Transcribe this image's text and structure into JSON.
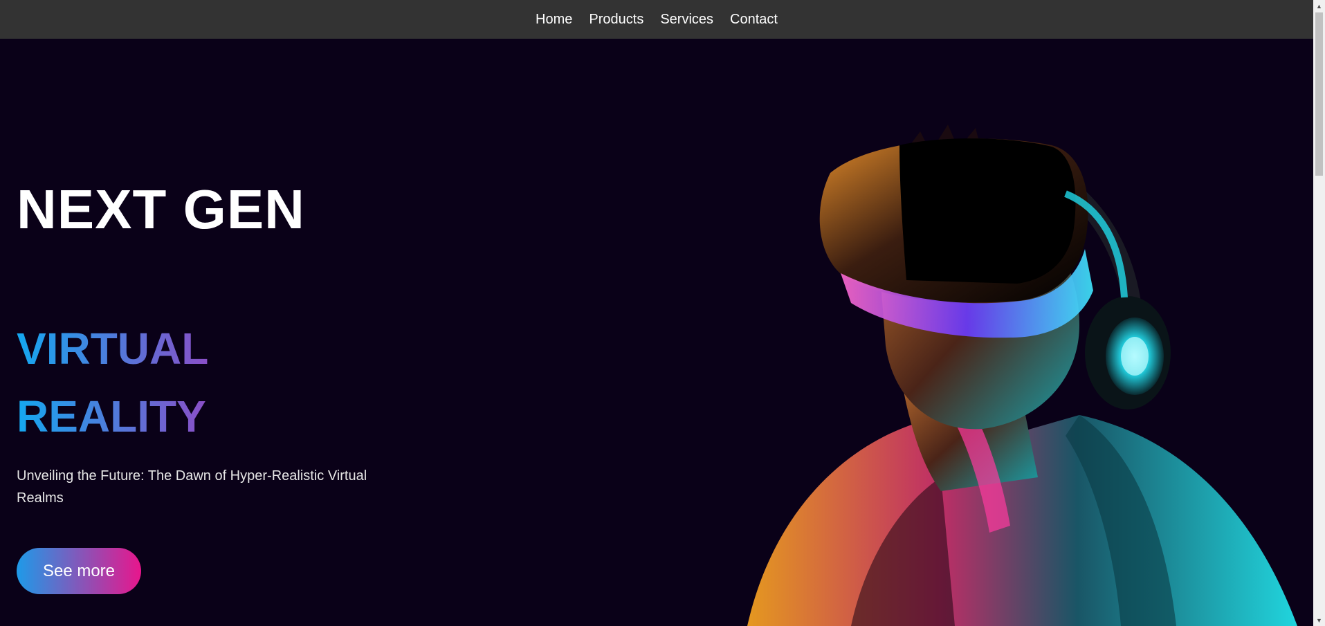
{
  "nav": {
    "items": [
      "Home",
      "Products",
      "Services",
      "Contact"
    ]
  },
  "hero": {
    "title": "NEXT GEN",
    "line1": "VIRTUAL",
    "line2": "REALITY",
    "description": "Unveiling the Future: The Dawn of Hyper-Realistic Virtual Realms",
    "cta_label": "See more"
  },
  "colors": {
    "nav_bg": "#333333",
    "page_bg": "#0a0118",
    "gradient_text_start": "#14a8f0",
    "gradient_text_end": "#8a4fc7",
    "button_gradient_start": "#1e9ae8",
    "button_gradient_end": "#e8168c"
  },
  "icons": {
    "scroll_up": "scroll-up-arrow-icon",
    "scroll_down": "scroll-down-arrow-icon"
  }
}
